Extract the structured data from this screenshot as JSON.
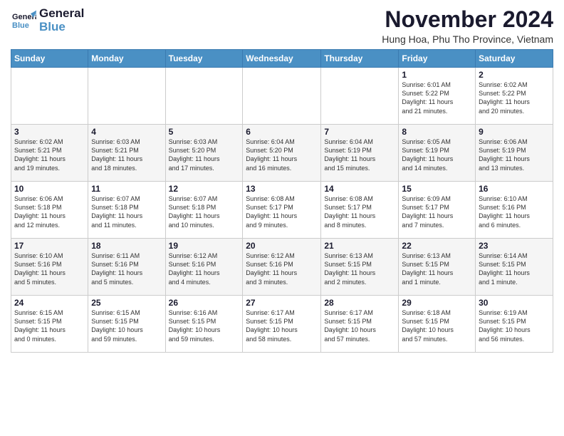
{
  "header": {
    "logo_general": "General",
    "logo_blue": "Blue",
    "month_title": "November 2024",
    "location": "Hung Hoa, Phu Tho Province, Vietnam"
  },
  "days_of_week": [
    "Sunday",
    "Monday",
    "Tuesday",
    "Wednesday",
    "Thursday",
    "Friday",
    "Saturday"
  ],
  "weeks": [
    {
      "row_bg": "odd",
      "days": [
        {
          "date": "",
          "info": ""
        },
        {
          "date": "",
          "info": ""
        },
        {
          "date": "",
          "info": ""
        },
        {
          "date": "",
          "info": ""
        },
        {
          "date": "",
          "info": ""
        },
        {
          "date": "1",
          "info": "Sunrise: 6:01 AM\nSunset: 5:22 PM\nDaylight: 11 hours\nand 21 minutes."
        },
        {
          "date": "2",
          "info": "Sunrise: 6:02 AM\nSunset: 5:22 PM\nDaylight: 11 hours\nand 20 minutes."
        }
      ]
    },
    {
      "row_bg": "even",
      "days": [
        {
          "date": "3",
          "info": "Sunrise: 6:02 AM\nSunset: 5:21 PM\nDaylight: 11 hours\nand 19 minutes."
        },
        {
          "date": "4",
          "info": "Sunrise: 6:03 AM\nSunset: 5:21 PM\nDaylight: 11 hours\nand 18 minutes."
        },
        {
          "date": "5",
          "info": "Sunrise: 6:03 AM\nSunset: 5:20 PM\nDaylight: 11 hours\nand 17 minutes."
        },
        {
          "date": "6",
          "info": "Sunrise: 6:04 AM\nSunset: 5:20 PM\nDaylight: 11 hours\nand 16 minutes."
        },
        {
          "date": "7",
          "info": "Sunrise: 6:04 AM\nSunset: 5:19 PM\nDaylight: 11 hours\nand 15 minutes."
        },
        {
          "date": "8",
          "info": "Sunrise: 6:05 AM\nSunset: 5:19 PM\nDaylight: 11 hours\nand 14 minutes."
        },
        {
          "date": "9",
          "info": "Sunrise: 6:06 AM\nSunset: 5:19 PM\nDaylight: 11 hours\nand 13 minutes."
        }
      ]
    },
    {
      "row_bg": "odd",
      "days": [
        {
          "date": "10",
          "info": "Sunrise: 6:06 AM\nSunset: 5:18 PM\nDaylight: 11 hours\nand 12 minutes."
        },
        {
          "date": "11",
          "info": "Sunrise: 6:07 AM\nSunset: 5:18 PM\nDaylight: 11 hours\nand 11 minutes."
        },
        {
          "date": "12",
          "info": "Sunrise: 6:07 AM\nSunset: 5:18 PM\nDaylight: 11 hours\nand 10 minutes."
        },
        {
          "date": "13",
          "info": "Sunrise: 6:08 AM\nSunset: 5:17 PM\nDaylight: 11 hours\nand 9 minutes."
        },
        {
          "date": "14",
          "info": "Sunrise: 6:08 AM\nSunset: 5:17 PM\nDaylight: 11 hours\nand 8 minutes."
        },
        {
          "date": "15",
          "info": "Sunrise: 6:09 AM\nSunset: 5:17 PM\nDaylight: 11 hours\nand 7 minutes."
        },
        {
          "date": "16",
          "info": "Sunrise: 6:10 AM\nSunset: 5:16 PM\nDaylight: 11 hours\nand 6 minutes."
        }
      ]
    },
    {
      "row_bg": "even",
      "days": [
        {
          "date": "17",
          "info": "Sunrise: 6:10 AM\nSunset: 5:16 PM\nDaylight: 11 hours\nand 5 minutes."
        },
        {
          "date": "18",
          "info": "Sunrise: 6:11 AM\nSunset: 5:16 PM\nDaylight: 11 hours\nand 5 minutes."
        },
        {
          "date": "19",
          "info": "Sunrise: 6:12 AM\nSunset: 5:16 PM\nDaylight: 11 hours\nand 4 minutes."
        },
        {
          "date": "20",
          "info": "Sunrise: 6:12 AM\nSunset: 5:16 PM\nDaylight: 11 hours\nand 3 minutes."
        },
        {
          "date": "21",
          "info": "Sunrise: 6:13 AM\nSunset: 5:15 PM\nDaylight: 11 hours\nand 2 minutes."
        },
        {
          "date": "22",
          "info": "Sunrise: 6:13 AM\nSunset: 5:15 PM\nDaylight: 11 hours\nand 1 minute."
        },
        {
          "date": "23",
          "info": "Sunrise: 6:14 AM\nSunset: 5:15 PM\nDaylight: 11 hours\nand 1 minute."
        }
      ]
    },
    {
      "row_bg": "odd",
      "days": [
        {
          "date": "24",
          "info": "Sunrise: 6:15 AM\nSunset: 5:15 PM\nDaylight: 11 hours\nand 0 minutes."
        },
        {
          "date": "25",
          "info": "Sunrise: 6:15 AM\nSunset: 5:15 PM\nDaylight: 10 hours\nand 59 minutes."
        },
        {
          "date": "26",
          "info": "Sunrise: 6:16 AM\nSunset: 5:15 PM\nDaylight: 10 hours\nand 59 minutes."
        },
        {
          "date": "27",
          "info": "Sunrise: 6:17 AM\nSunset: 5:15 PM\nDaylight: 10 hours\nand 58 minutes."
        },
        {
          "date": "28",
          "info": "Sunrise: 6:17 AM\nSunset: 5:15 PM\nDaylight: 10 hours\nand 57 minutes."
        },
        {
          "date": "29",
          "info": "Sunrise: 6:18 AM\nSunset: 5:15 PM\nDaylight: 10 hours\nand 57 minutes."
        },
        {
          "date": "30",
          "info": "Sunrise: 6:19 AM\nSunset: 5:15 PM\nDaylight: 10 hours\nand 56 minutes."
        }
      ]
    }
  ]
}
